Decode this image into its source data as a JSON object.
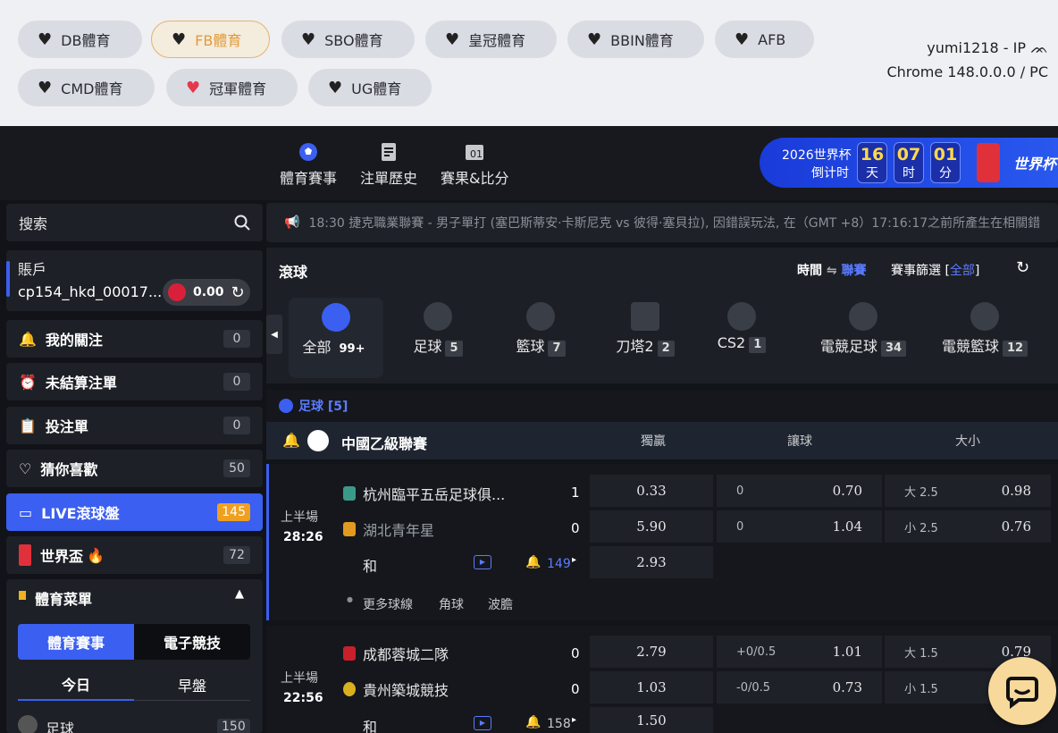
{
  "topbar": {
    "pills": [
      {
        "label": "DB體育",
        "selected": false,
        "heart": "black"
      },
      {
        "label": "FB體育",
        "selected": true,
        "heart": "black"
      },
      {
        "label": "SBO體育",
        "selected": false,
        "heart": "black"
      },
      {
        "label": "皇冠體育",
        "selected": false,
        "heart": "black"
      },
      {
        "label": "BBIN體育",
        "selected": false,
        "heart": "black"
      },
      {
        "label": "AFB",
        "selected": false,
        "heart": "black"
      },
      {
        "label": "CMD體育",
        "selected": false,
        "heart": "black"
      },
      {
        "label": "冠軍體育",
        "selected": false,
        "heart": "red"
      },
      {
        "label": "UG體育",
        "selected": false,
        "heart": "black"
      }
    ],
    "user_line": "yumi1218 - IP",
    "browser_line": "Chrome 148.0.0.0 / PC"
  },
  "nav": {
    "sports": "體育賽事",
    "history": "注單歷史",
    "results": "賽果&比分"
  },
  "worldcup_banner": {
    "title": "2026世界杯",
    "subtitle": "倒计时",
    "days": "16",
    "days_unit": "天",
    "hours": "07",
    "hours_unit": "时",
    "minutes": "01",
    "minutes_unit": "分",
    "logo_text": "世界杯"
  },
  "sidebar": {
    "search_label": "搜索",
    "account_label": "賬戶",
    "account_name": "cp154_hkd_00017...",
    "balance": "0.00",
    "items": [
      {
        "label": "我的關注",
        "count": "0",
        "icon": "bell-icon"
      },
      {
        "label": "未結算注單",
        "count": "0",
        "icon": "alarm-clock-icon"
      },
      {
        "label": "投注單",
        "count": "0",
        "icon": "betslip-icon"
      },
      {
        "label": "猜你喜歡",
        "count": "50",
        "icon": "heart-outline-icon"
      },
      {
        "label": "LIVE滾球盤",
        "count": "145",
        "icon": "live-icon"
      },
      {
        "label": "世界盃",
        "count": "72",
        "icon": "trophy-icon"
      }
    ],
    "menu_title": "體育菜單",
    "tab_sports": "體育賽事",
    "tab_esports": "電子競技",
    "sub_today": "今日",
    "sub_early": "早盤",
    "first_sport": "足球",
    "first_sport_count": "150"
  },
  "marquee": "18:30 捷克職業聯賽 - 男子單打 (塞巴斯蒂安·卡斯尼克 vs 彼得·塞貝拉), 因錯誤玩法, 在（GMT +8）17:16:17之前所產生在相關錯",
  "main": {
    "title": "滾球",
    "sort_time": "時間",
    "sort_league": "聯賽",
    "filter_label": "賽事篩選 [",
    "filter_value": "全部",
    "filter_close": "]",
    "categories": [
      {
        "label": "全部",
        "count": "99+",
        "active": true
      },
      {
        "label": "足球",
        "count": "5"
      },
      {
        "label": "籃球",
        "count": "7"
      },
      {
        "label": "刀塔2",
        "count": "2"
      },
      {
        "label": "CS2",
        "count": "1"
      },
      {
        "label": "電競足球",
        "count": "34"
      },
      {
        "label": "電競籃球",
        "count": "12"
      }
    ],
    "section_label": "足球 [5]",
    "league": "中國乙級聯賽",
    "col_1x2": "獨贏",
    "col_handicap": "讓球",
    "col_ou": "大小",
    "matches": [
      {
        "period": "上半場",
        "clock": "28:26",
        "home": "杭州臨平五岳足球俱...",
        "away": "湖北青年星",
        "draw": "和",
        "home_score": "1",
        "away_score": "0",
        "odds_home": "0.33",
        "odds_away": "5.90",
        "odds_draw": "2.93",
        "hdp_home": "0",
        "hdp_home_odds": "0.70",
        "hdp_away": "0",
        "hdp_away_odds": "1.04",
        "ou_over": "大 2.5",
        "ou_over_odds": "0.98",
        "ou_under": "小 2.5",
        "ou_under_odds": "0.76",
        "markets": "149",
        "more_lines": "更多球線",
        "corners": "角球",
        "correct_score": "波膽"
      },
      {
        "period": "上半場",
        "clock": "22:56",
        "home": "成都蓉城二隊",
        "away": "貴州築城競技",
        "draw": "和",
        "home_score": "0",
        "away_score": "0",
        "odds_home": "2.79",
        "odds_away": "1.03",
        "odds_draw": "1.50",
        "hdp_home": "+0/0.5",
        "hdp_home_odds": "1.01",
        "hdp_away": "-0/0.5",
        "hdp_away_odds": "0.73",
        "ou_over": "大 1.5",
        "ou_over_odds": "0.79",
        "ou_under": "小 1.5",
        "ou_under_odds": "",
        "markets": "158"
      }
    ]
  },
  "colors": {
    "accent": "#3b5ff0",
    "selected_pill_border": "#e4b36f",
    "countdown_digits": "#ffd94a",
    "chat_bubble": "#f7d99b"
  }
}
